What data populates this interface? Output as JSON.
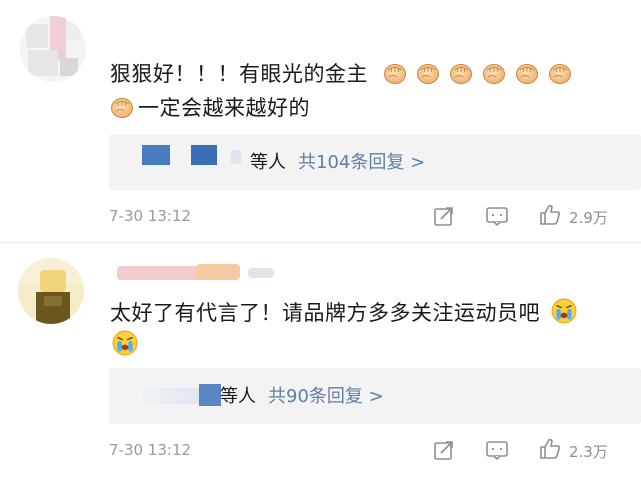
{
  "comments": [
    {
      "text_line1": "狠狠好！！！有眼光的金主",
      "text_line2": "一定会越来越好的",
      "emoji_name": "fist-emoji",
      "reply_prefix": "等人",
      "reply_count_label": "共104条回复 >",
      "time": "7-30 13:12",
      "likes": "2.9万"
    },
    {
      "text_line1": "太好了有代言了！请品牌方多多关注运动员吧",
      "emoji_name": "crying-face-emoji",
      "reply_prefix": "等人",
      "reply_count_label": "共90条回复 >",
      "time": "7-30 13:12",
      "likes": "2.3万"
    }
  ],
  "colors": {
    "link": "#5e7fa8",
    "meta": "#9a9a9a",
    "reply_bg": "#f3f3f3",
    "mosaic_blue": "#4a7cc0"
  }
}
